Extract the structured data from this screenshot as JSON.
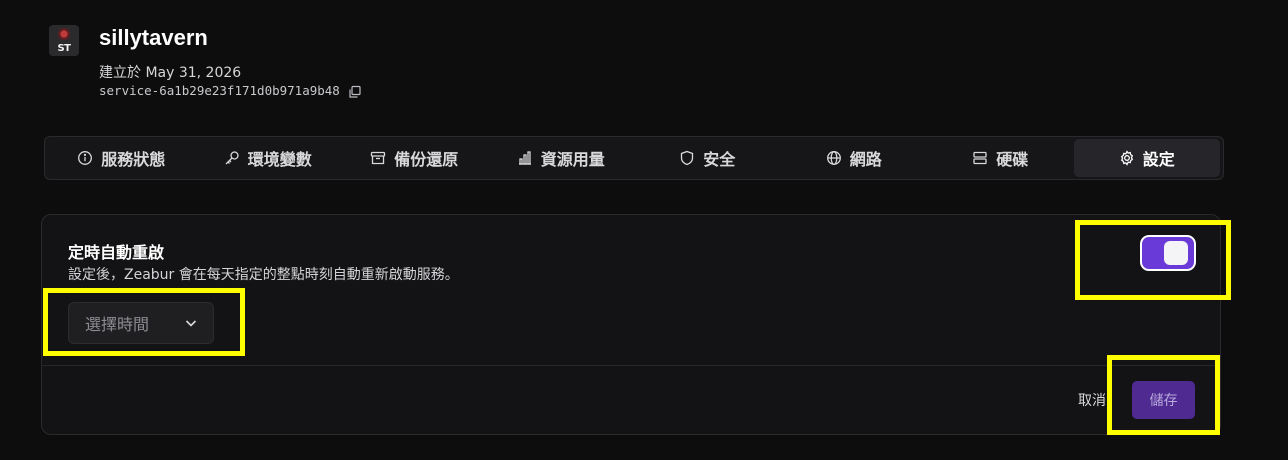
{
  "header": {
    "logo_text": "ST",
    "service_name": "sillytavern",
    "created_at": "建立於 May 31, 2026",
    "service_id": "service-6a1b29e23f171d0b971a9b48"
  },
  "tabs": [
    {
      "label": "服務狀態",
      "icon": "info-icon"
    },
    {
      "label": "環境變數",
      "icon": "key-icon"
    },
    {
      "label": "備份還原",
      "icon": "archive-icon"
    },
    {
      "label": "資源用量",
      "icon": "bar-chart-icon"
    },
    {
      "label": "安全",
      "icon": "shield-icon"
    },
    {
      "label": "網路",
      "icon": "globe-icon"
    },
    {
      "label": "硬碟",
      "icon": "server-icon"
    },
    {
      "label": "設定",
      "icon": "gear-icon",
      "active": true
    }
  ],
  "settings_card": {
    "title": "定時自動重啟",
    "description": "設定後，Zeabur 會在每天指定的整點時刻自動重新啟動服務。",
    "time_select_placeholder": "選擇時間",
    "toggle_on": true,
    "cancel_label": "取消",
    "save_label": "儲存"
  },
  "colors": {
    "accent": "#6a3ad9",
    "save_button": "#4e2a91",
    "highlight": "#ffff00",
    "background": "#0d0d0e"
  }
}
